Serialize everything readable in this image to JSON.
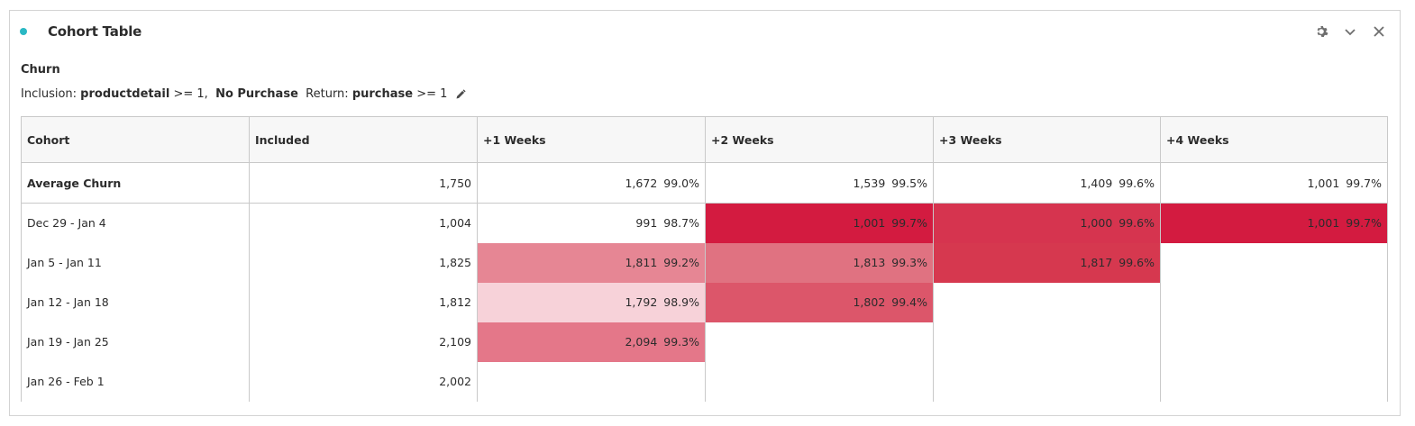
{
  "panel": {
    "title": "Cohort Table",
    "status_color": "#2ab8c4",
    "icons": [
      "gear-icon",
      "chevron-down-icon",
      "close-icon"
    ]
  },
  "segment": {
    "name": "Churn",
    "inclusion_label": "Inclusion:",
    "inclusion_metric": "productdetail",
    "inclusion_op": ">= 1,",
    "inclusion_dimension": "No Purchase",
    "return_label": "Return:",
    "return_metric": "purchase",
    "return_op": ">= 1"
  },
  "table": {
    "headers": [
      "Cohort",
      "Included",
      "+1 Weeks",
      "+2 Weeks",
      "+3 Weeks",
      "+4 Weeks"
    ],
    "average": {
      "label": "Average Churn",
      "included": "1,750",
      "cells": [
        {
          "value": "1,672",
          "pct": "99.0%"
        },
        {
          "value": "1,539",
          "pct": "99.5%"
        },
        {
          "value": "1,409",
          "pct": "99.6%"
        },
        {
          "value": "1,001",
          "pct": "99.7%"
        }
      ]
    },
    "rows": [
      {
        "label": "Dec 29 - Jan 4",
        "included": "1,004",
        "cells": [
          {
            "value": "991",
            "pct": "98.7%",
            "bg": "#ffffff"
          },
          {
            "value": "1,001",
            "pct": "99.7%",
            "bg": "#d31b40"
          },
          {
            "value": "1,000",
            "pct": "99.6%",
            "bg": "#d6344f"
          },
          {
            "value": "1,001",
            "pct": "99.7%",
            "bg": "#d31b40"
          }
        ]
      },
      {
        "label": "Jan 5 - Jan 11",
        "included": "1,825",
        "cells": [
          {
            "value": "1,811",
            "pct": "99.2%",
            "bg": "#e68694"
          },
          {
            "value": "1,813",
            "pct": "99.3%",
            "bg": "#e07281"
          },
          {
            "value": "1,817",
            "pct": "99.6%",
            "bg": "#d6384f"
          },
          {
            "value": "",
            "pct": "",
            "bg": "#ffffff"
          }
        ]
      },
      {
        "label": "Jan 12 - Jan 18",
        "included": "1,812",
        "cells": [
          {
            "value": "1,792",
            "pct": "98.9%",
            "bg": "#f7d2d9"
          },
          {
            "value": "1,802",
            "pct": "99.4%",
            "bg": "#dc566a"
          },
          {
            "value": "",
            "pct": "",
            "bg": "#ffffff"
          },
          {
            "value": "",
            "pct": "",
            "bg": "#ffffff"
          }
        ]
      },
      {
        "label": "Jan 19 - Jan 25",
        "included": "2,109",
        "cells": [
          {
            "value": "2,094",
            "pct": "99.3%",
            "bg": "#e47789"
          },
          {
            "value": "",
            "pct": "",
            "bg": "#ffffff"
          },
          {
            "value": "",
            "pct": "",
            "bg": "#ffffff"
          },
          {
            "value": "",
            "pct": "",
            "bg": "#ffffff"
          }
        ]
      },
      {
        "label": "Jan 26 - Feb 1",
        "included": "2,002",
        "cells": [
          {
            "value": "",
            "pct": "",
            "bg": "#ffffff"
          },
          {
            "value": "",
            "pct": "",
            "bg": "#ffffff"
          },
          {
            "value": "",
            "pct": "",
            "bg": "#ffffff"
          },
          {
            "value": "",
            "pct": "",
            "bg": "#ffffff"
          }
        ]
      }
    ]
  }
}
